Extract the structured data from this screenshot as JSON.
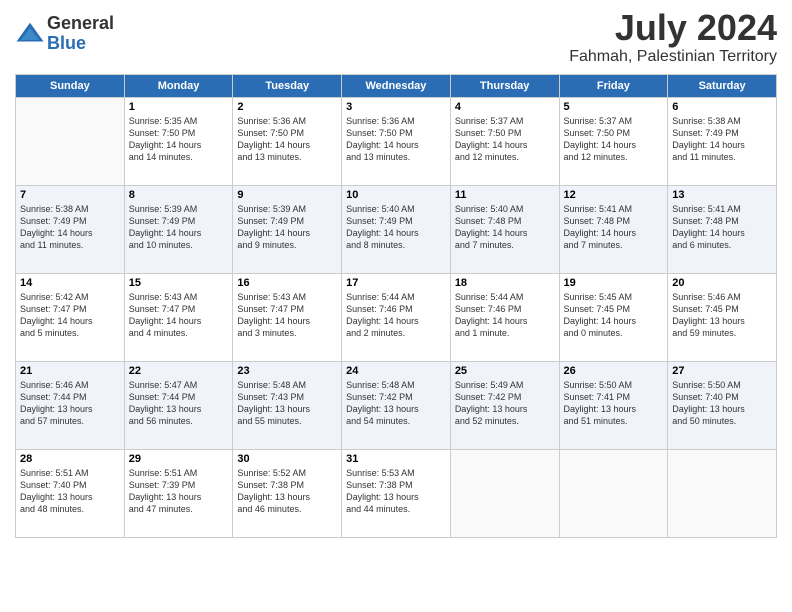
{
  "logo": {
    "general": "General",
    "blue": "Blue"
  },
  "title": "July 2024",
  "location": "Fahmah, Palestinian Territory",
  "weekdays": [
    "Sunday",
    "Monday",
    "Tuesday",
    "Wednesday",
    "Thursday",
    "Friday",
    "Saturday"
  ],
  "weeks": [
    [
      {
        "day": "",
        "sunrise": "",
        "sunset": "",
        "daylight": ""
      },
      {
        "day": "1",
        "sunrise": "Sunrise: 5:35 AM",
        "sunset": "Sunset: 7:50 PM",
        "daylight": "Daylight: 14 hours and 14 minutes."
      },
      {
        "day": "2",
        "sunrise": "Sunrise: 5:36 AM",
        "sunset": "Sunset: 7:50 PM",
        "daylight": "Daylight: 14 hours and 13 minutes."
      },
      {
        "day": "3",
        "sunrise": "Sunrise: 5:36 AM",
        "sunset": "Sunset: 7:50 PM",
        "daylight": "Daylight: 14 hours and 13 minutes."
      },
      {
        "day": "4",
        "sunrise": "Sunrise: 5:37 AM",
        "sunset": "Sunset: 7:50 PM",
        "daylight": "Daylight: 14 hours and 12 minutes."
      },
      {
        "day": "5",
        "sunrise": "Sunrise: 5:37 AM",
        "sunset": "Sunset: 7:50 PM",
        "daylight": "Daylight: 14 hours and 12 minutes."
      },
      {
        "day": "6",
        "sunrise": "Sunrise: 5:38 AM",
        "sunset": "Sunset: 7:49 PM",
        "daylight": "Daylight: 14 hours and 11 minutes."
      }
    ],
    [
      {
        "day": "7",
        "sunrise": "Sunrise: 5:38 AM",
        "sunset": "Sunset: 7:49 PM",
        "daylight": "Daylight: 14 hours and 11 minutes."
      },
      {
        "day": "8",
        "sunrise": "Sunrise: 5:39 AM",
        "sunset": "Sunset: 7:49 PM",
        "daylight": "Daylight: 14 hours and 10 minutes."
      },
      {
        "day": "9",
        "sunrise": "Sunrise: 5:39 AM",
        "sunset": "Sunset: 7:49 PM",
        "daylight": "Daylight: 14 hours and 9 minutes."
      },
      {
        "day": "10",
        "sunrise": "Sunrise: 5:40 AM",
        "sunset": "Sunset: 7:49 PM",
        "daylight": "Daylight: 14 hours and 8 minutes."
      },
      {
        "day": "11",
        "sunrise": "Sunrise: 5:40 AM",
        "sunset": "Sunset: 7:48 PM",
        "daylight": "Daylight: 14 hours and 7 minutes."
      },
      {
        "day": "12",
        "sunrise": "Sunrise: 5:41 AM",
        "sunset": "Sunset: 7:48 PM",
        "daylight": "Daylight: 14 hours and 7 minutes."
      },
      {
        "day": "13",
        "sunrise": "Sunrise: 5:41 AM",
        "sunset": "Sunset: 7:48 PM",
        "daylight": "Daylight: 14 hours and 6 minutes."
      }
    ],
    [
      {
        "day": "14",
        "sunrise": "Sunrise: 5:42 AM",
        "sunset": "Sunset: 7:47 PM",
        "daylight": "Daylight: 14 hours and 5 minutes."
      },
      {
        "day": "15",
        "sunrise": "Sunrise: 5:43 AM",
        "sunset": "Sunset: 7:47 PM",
        "daylight": "Daylight: 14 hours and 4 minutes."
      },
      {
        "day": "16",
        "sunrise": "Sunrise: 5:43 AM",
        "sunset": "Sunset: 7:47 PM",
        "daylight": "Daylight: 14 hours and 3 minutes."
      },
      {
        "day": "17",
        "sunrise": "Sunrise: 5:44 AM",
        "sunset": "Sunset: 7:46 PM",
        "daylight": "Daylight: 14 hours and 2 minutes."
      },
      {
        "day": "18",
        "sunrise": "Sunrise: 5:44 AM",
        "sunset": "Sunset: 7:46 PM",
        "daylight": "Daylight: 14 hours and 1 minute."
      },
      {
        "day": "19",
        "sunrise": "Sunrise: 5:45 AM",
        "sunset": "Sunset: 7:45 PM",
        "daylight": "Daylight: 14 hours and 0 minutes."
      },
      {
        "day": "20",
        "sunrise": "Sunrise: 5:46 AM",
        "sunset": "Sunset: 7:45 PM",
        "daylight": "Daylight: 13 hours and 59 minutes."
      }
    ],
    [
      {
        "day": "21",
        "sunrise": "Sunrise: 5:46 AM",
        "sunset": "Sunset: 7:44 PM",
        "daylight": "Daylight: 13 hours and 57 minutes."
      },
      {
        "day": "22",
        "sunrise": "Sunrise: 5:47 AM",
        "sunset": "Sunset: 7:44 PM",
        "daylight": "Daylight: 13 hours and 56 minutes."
      },
      {
        "day": "23",
        "sunrise": "Sunrise: 5:48 AM",
        "sunset": "Sunset: 7:43 PM",
        "daylight": "Daylight: 13 hours and 55 minutes."
      },
      {
        "day": "24",
        "sunrise": "Sunrise: 5:48 AM",
        "sunset": "Sunset: 7:42 PM",
        "daylight": "Daylight: 13 hours and 54 minutes."
      },
      {
        "day": "25",
        "sunrise": "Sunrise: 5:49 AM",
        "sunset": "Sunset: 7:42 PM",
        "daylight": "Daylight: 13 hours and 52 minutes."
      },
      {
        "day": "26",
        "sunrise": "Sunrise: 5:50 AM",
        "sunset": "Sunset: 7:41 PM",
        "daylight": "Daylight: 13 hours and 51 minutes."
      },
      {
        "day": "27",
        "sunrise": "Sunrise: 5:50 AM",
        "sunset": "Sunset: 7:40 PM",
        "daylight": "Daylight: 13 hours and 50 minutes."
      }
    ],
    [
      {
        "day": "28",
        "sunrise": "Sunrise: 5:51 AM",
        "sunset": "Sunset: 7:40 PM",
        "daylight": "Daylight: 13 hours and 48 minutes."
      },
      {
        "day": "29",
        "sunrise": "Sunrise: 5:51 AM",
        "sunset": "Sunset: 7:39 PM",
        "daylight": "Daylight: 13 hours and 47 minutes."
      },
      {
        "day": "30",
        "sunrise": "Sunrise: 5:52 AM",
        "sunset": "Sunset: 7:38 PM",
        "daylight": "Daylight: 13 hours and 46 minutes."
      },
      {
        "day": "31",
        "sunrise": "Sunrise: 5:53 AM",
        "sunset": "Sunset: 7:38 PM",
        "daylight": "Daylight: 13 hours and 44 minutes."
      },
      {
        "day": "",
        "sunrise": "",
        "sunset": "",
        "daylight": ""
      },
      {
        "day": "",
        "sunrise": "",
        "sunset": "",
        "daylight": ""
      },
      {
        "day": "",
        "sunrise": "",
        "sunset": "",
        "daylight": ""
      }
    ]
  ]
}
